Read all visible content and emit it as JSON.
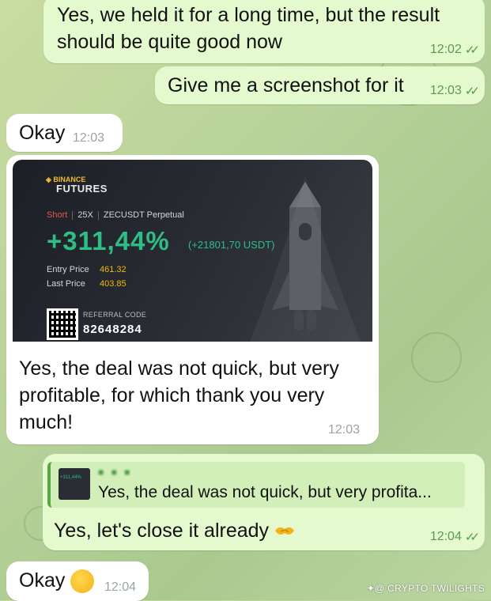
{
  "messages": {
    "m1": {
      "text_line1": "Yes, we held it for a long time, but the result",
      "text_line2": "should be quite good now",
      "time": "12:02"
    },
    "m2": {
      "text": "Give me a screenshot for it",
      "time": "12:03"
    },
    "m3": {
      "text": "Okay",
      "time": "12:03"
    },
    "m4": {
      "card": {
        "brand_top": "BINANCE",
        "brand_bottom": "FUTURES",
        "side": "Short",
        "leverage": "25X",
        "contract": "ZECUSDT Perpetual",
        "pnl_percent": "+311,44%",
        "pnl_amount": "(+21801,70 USDT)",
        "entry_label": "Entry Price",
        "entry_value": "461.32",
        "last_label": "Last Price",
        "last_value": "403.85",
        "referral_label": "REFERRAL CODE",
        "referral_code": "82648284"
      },
      "text_line1": "Yes, the deal was not quick, but very",
      "text_line2": "profitable, for which thank you very",
      "text_line3": "much!",
      "time": "12:03"
    },
    "m5": {
      "reply_thumb_text": "+311,44%",
      "reply_name": "■ ■ ■",
      "reply_text": "Yes, the deal was not quick, but very profita...",
      "text": "Yes, let's close it already",
      "time": "12:04"
    },
    "m6": {
      "text": "Okay",
      "time": "12:04"
    }
  },
  "watermark": "✦@ CRYPTO TWILIGHTS",
  "colors": {
    "outgoing": "#e5f9cf",
    "incoming": "#ffffff",
    "profit": "#2ebd85",
    "accent": "#4f9a45"
  }
}
